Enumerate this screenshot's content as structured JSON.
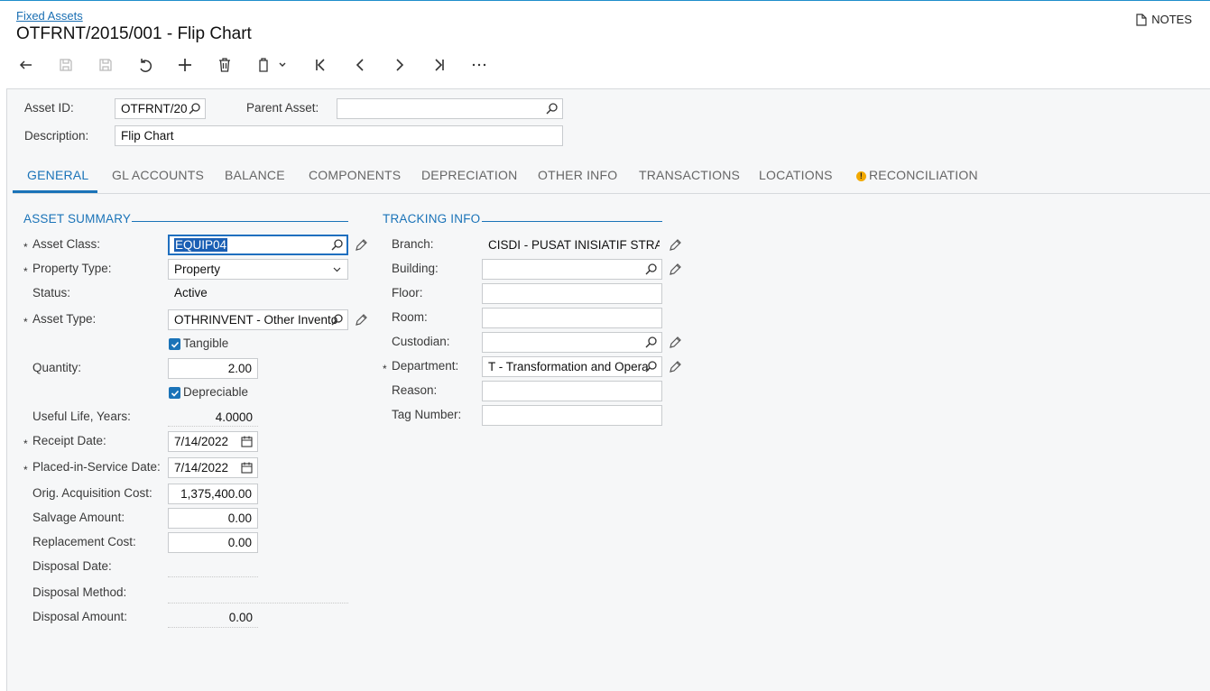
{
  "header": {
    "breadcrumb": "Fixed Assets",
    "title": "OTFRNT/2015/001 - Flip Chart",
    "notes_label": "NOTES"
  },
  "toolbar": {
    "icons": [
      "back-icon",
      "save-close-icon",
      "save-icon",
      "undo-icon",
      "add-icon",
      "delete-icon",
      "copy-paste-icon",
      "first-record-icon",
      "previous-record-icon",
      "next-record-icon",
      "last-record-icon",
      "more-icon"
    ]
  },
  "form": {
    "asset_id_label": "Asset ID:",
    "asset_id_value": "OTFRNT/20",
    "parent_asset_label": "Parent Asset:",
    "parent_asset_value": "",
    "description_label": "Description:",
    "description_value": "Flip Chart"
  },
  "tabs": [
    {
      "label": "GENERAL",
      "active": true
    },
    {
      "label": "GL ACCOUNTS"
    },
    {
      "label": "BALANCE"
    },
    {
      "label": "COMPONENTS"
    },
    {
      "label": "DEPRECIATION"
    },
    {
      "label": "OTHER INFO"
    },
    {
      "label": "TRANSACTIONS"
    },
    {
      "label": "LOCATIONS"
    },
    {
      "label": "RECONCILIATION",
      "warning": true,
      "warning_glyph": "!"
    }
  ],
  "asset_summary": {
    "title": "ASSET SUMMARY",
    "required_marker": "*",
    "asset_class_label": "Asset Class:",
    "asset_class_value": "EQUIP04",
    "property_type_label": "Property Type:",
    "property_type_value": "Property",
    "status_label": "Status:",
    "status_value": "Active",
    "asset_type_label": "Asset Type:",
    "asset_type_value": "OTHRINVENT - Other Invento",
    "tangible_label": "Tangible",
    "tangible_checked": true,
    "quantity_label": "Quantity:",
    "quantity_value": "2.00",
    "depreciable_label": "Depreciable",
    "depreciable_checked": true,
    "useful_life_label": "Useful Life, Years:",
    "useful_life_value": "4.0000",
    "receipt_date_label": "Receipt Date:",
    "receipt_date_value": "7/14/2022",
    "placed_in_service_label": "Placed-in-Service Date:",
    "placed_in_service_value": "7/14/2022",
    "orig_acq_cost_label": "Orig. Acquisition Cost:",
    "orig_acq_cost_value": "1,375,400.00",
    "salvage_amount_label": "Salvage Amount:",
    "salvage_amount_value": "0.00",
    "replacement_cost_label": "Replacement Cost:",
    "replacement_cost_value": "0.00",
    "disposal_date_label": "Disposal Date:",
    "disposal_method_label": "Disposal Method:",
    "disposal_amount_label": "Disposal Amount:",
    "disposal_amount_value": "0.00"
  },
  "tracking_info": {
    "title": "TRACKING INFO",
    "required_marker": "*",
    "branch_label": "Branch:",
    "branch_value": "CISDI - PUSAT INISIATIF STRAT",
    "building_label": "Building:",
    "building_value": "",
    "floor_label": "Floor:",
    "room_label": "Room:",
    "custodian_label": "Custodian:",
    "custodian_value": "",
    "department_label": "Department:",
    "department_value": "T - Transformation and Opera",
    "reason_label": "Reason:",
    "tag_number_label": "Tag Number:"
  },
  "colors": {
    "accent": "#1a73b8",
    "panel_bg": "#f6f7f8",
    "warning": "#f2a900"
  }
}
